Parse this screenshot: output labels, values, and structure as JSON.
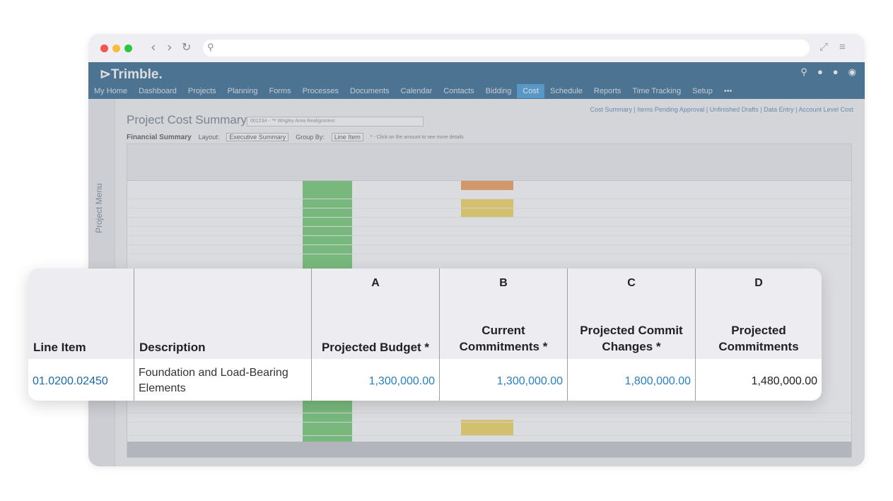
{
  "app": {
    "logo": "Trimble.",
    "menu": [
      "My Home",
      "Dashboard",
      "Projects",
      "Planning",
      "Forms",
      "Processes",
      "Documents",
      "Calendar",
      "Contacts",
      "Bidding",
      "Cost",
      "Schedule",
      "Reports",
      "Time Tracking",
      "Setup",
      "•••"
    ],
    "active_menu": "Cost",
    "sidebar_label": "Project Menu",
    "page_title": "Project Cost Summary",
    "project_select": "001234 - ™ Wrigley Area Realignment",
    "financial_summary": "Financial Summary",
    "layout_label": "Layout:",
    "layout_value": "Executive Summary",
    "group_label": "Group By:",
    "group_value": "Line Item",
    "hint": "* - Click on the amount to see more details",
    "subnav": "Cost Summary  |  Items Pending Approval  |  Unfinished Drafts  |  Data Entry  |  Account Level Cost"
  },
  "zoom": {
    "columns": [
      {
        "letter": "",
        "header": "Line Item"
      },
      {
        "letter": "",
        "header": "Description"
      },
      {
        "letter": "A",
        "header": "Projected Budget *"
      },
      {
        "letter": "B",
        "header": "Current\nCommitments *"
      },
      {
        "letter": "C",
        "header": "Projected Commit\nChanges *"
      },
      {
        "letter": "D",
        "header": "Projected\nCommitments"
      }
    ],
    "row": {
      "line_item": "01.0200.02450",
      "description": "Foundation and Load-Bearing Elements",
      "projected_budget": "1,300,000.00",
      "current_commitments": "1,300,000.00",
      "projected_commit_changes": "1,800,000.00",
      "projected_commitments": "1,480,000.00"
    }
  },
  "colors": {
    "brand": "#0b4a7a",
    "active_tab": "#1e8ad6",
    "link": "#1f6aa5"
  }
}
